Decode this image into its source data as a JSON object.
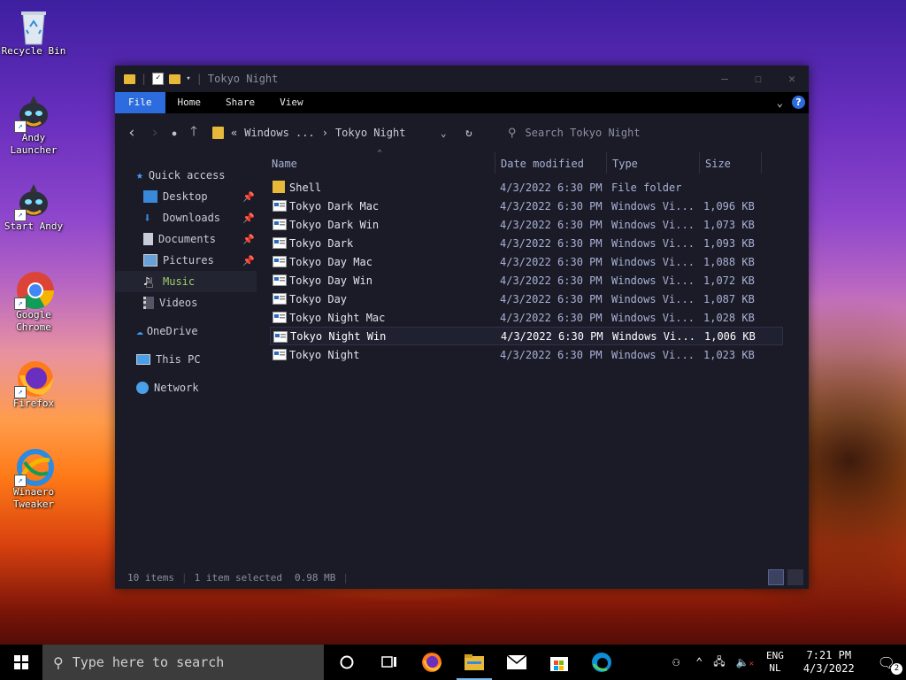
{
  "desktop": {
    "icons": [
      {
        "label": "Recycle Bin",
        "icon": "recycle-bin-icon"
      },
      {
        "label": "Andy Launcher",
        "icon": "andy-icon"
      },
      {
        "label": "Start Andy",
        "icon": "andy-icon"
      },
      {
        "label": "Google Chrome",
        "icon": "chrome-icon"
      },
      {
        "label": "Firefox",
        "icon": "firefox-icon"
      },
      {
        "label": "Winaero Tweaker",
        "icon": "winaero-icon"
      }
    ]
  },
  "window": {
    "title": "Tokyo Night",
    "ribbon_tabs": [
      "File",
      "Home",
      "Share",
      "View"
    ],
    "help_label": "?",
    "address": {
      "prefix": "«",
      "crumbs": [
        "Windows ...",
        "Tokyo Night"
      ]
    },
    "search_placeholder": "Search Tokyo Night",
    "sidebar": {
      "quick_access": "Quick access",
      "items": [
        "Desktop",
        "Downloads",
        "Documents",
        "Pictures",
        "Music",
        "Videos"
      ],
      "onedrive": "OneDrive",
      "this_pc": "This PC",
      "network": "Network"
    },
    "columns": [
      "Name",
      "Date modified",
      "Type",
      "Size"
    ],
    "files": [
      {
        "name": "Shell",
        "date": "4/3/2022 6:30 PM",
        "type": "File folder",
        "size": "",
        "kind": "folder"
      },
      {
        "name": "Tokyo Dark Mac",
        "date": "4/3/2022 6:30 PM",
        "type": "Windows Vi...",
        "size": "1,096 KB",
        "kind": "file"
      },
      {
        "name": "Tokyo Dark Win",
        "date": "4/3/2022 6:30 PM",
        "type": "Windows Vi...",
        "size": "1,073 KB",
        "kind": "file"
      },
      {
        "name": "Tokyo Dark",
        "date": "4/3/2022 6:30 PM",
        "type": "Windows Vi...",
        "size": "1,093 KB",
        "kind": "file"
      },
      {
        "name": "Tokyo Day Mac",
        "date": "4/3/2022 6:30 PM",
        "type": "Windows Vi...",
        "size": "1,088 KB",
        "kind": "file"
      },
      {
        "name": "Tokyo Day Win",
        "date": "4/3/2022 6:30 PM",
        "type": "Windows Vi...",
        "size": "1,072 KB",
        "kind": "file"
      },
      {
        "name": "Tokyo Day",
        "date": "4/3/2022 6:30 PM",
        "type": "Windows Vi...",
        "size": "1,087 KB",
        "kind": "file"
      },
      {
        "name": "Tokyo Night Mac",
        "date": "4/3/2022 6:30 PM",
        "type": "Windows Vi...",
        "size": "1,028 KB",
        "kind": "file"
      },
      {
        "name": "Tokyo Night Win",
        "date": "4/3/2022 6:30 PM",
        "type": "Windows Vi...",
        "size": "1,006 KB",
        "kind": "file",
        "selected": true
      },
      {
        "name": "Tokyo Night",
        "date": "4/3/2022 6:30 PM",
        "type": "Windows Vi...",
        "size": "1,023 KB",
        "kind": "file"
      }
    ],
    "status": {
      "count": "10 items",
      "selected": "1 item selected",
      "size": "0.98 MB"
    }
  },
  "taskbar": {
    "search_placeholder": "Type here to search",
    "lang_top": "ENG",
    "lang_bottom": "NL",
    "time": "7:21 PM",
    "date": "4/3/2022",
    "notifications": "2"
  },
  "colors": {
    "accent": "#2d6cdf",
    "window_bg": "#1a1b26",
    "hover_text": "#9ece6a"
  }
}
